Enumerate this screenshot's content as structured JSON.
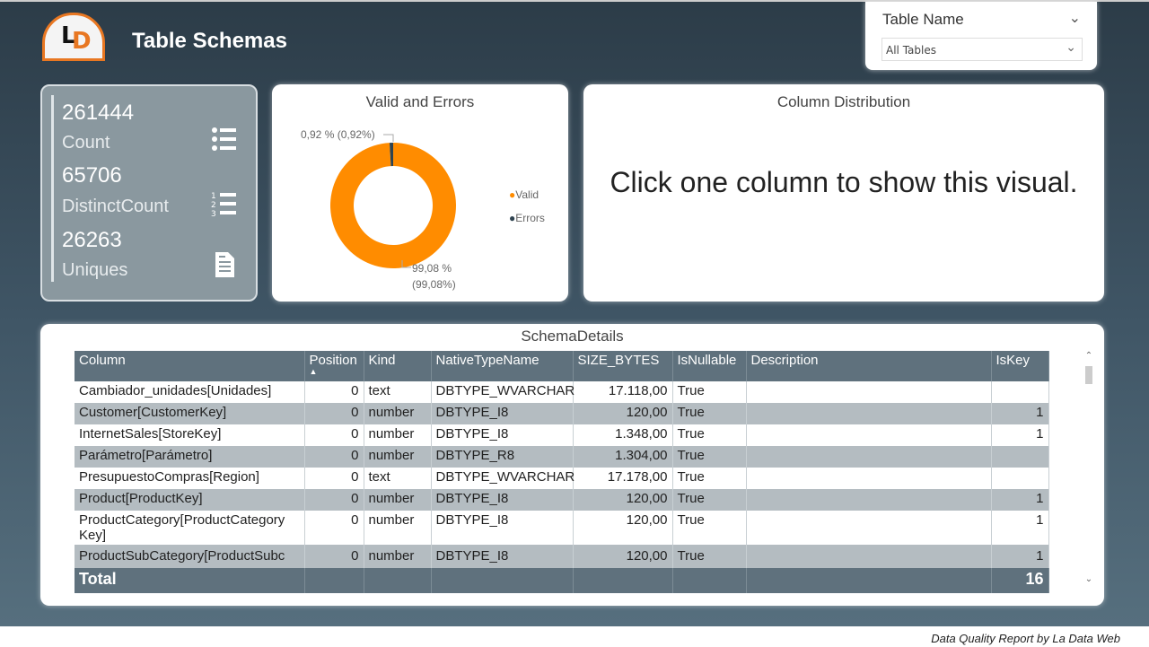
{
  "header": {
    "title": "Table Schemas",
    "logo_text": "LD"
  },
  "slicer": {
    "title": "Table Name",
    "selected": "All Tables"
  },
  "kpis": [
    {
      "value": "261444",
      "label": "Count",
      "icon": "bullet-list-icon"
    },
    {
      "value": "65706",
      "label": "DistinctCount",
      "icon": "numbered-list-icon"
    },
    {
      "value": "26263",
      "label": "Uniques",
      "icon": "document-icon"
    }
  ],
  "donut": {
    "title": "Valid and Errors",
    "errors_label": "0,92 % (0,92%)",
    "valid_label_1": "99,08 %",
    "valid_label_2": "(99,08%)",
    "legend": [
      "Valid",
      "Errors"
    ],
    "chart_data": {
      "type": "pie",
      "categories": [
        "Valid",
        "Errors"
      ],
      "values": [
        99.08,
        0.92
      ],
      "colors": [
        "#ff8c00",
        "#2f4350"
      ],
      "legend": "right"
    }
  },
  "distribution": {
    "title": "Column Distribution",
    "message": "Click one column to show this visual."
  },
  "schema": {
    "title": "SchemaDetails",
    "columns": [
      "Column",
      "Position",
      "Kind",
      "NativeTypeName",
      "SIZE_BYTES",
      "IsNullable",
      "Description",
      "IsKey"
    ],
    "rows": [
      [
        "Cambiador_unidades[Unidades]",
        "0",
        "text",
        "DBTYPE_WVARCHAR",
        "17.118,00",
        "True",
        "",
        ""
      ],
      [
        "Customer[CustomerKey]",
        "0",
        "number",
        "DBTYPE_I8",
        "120,00",
        "True",
        "",
        "1"
      ],
      [
        "InternetSales[StoreKey]",
        "0",
        "number",
        "DBTYPE_I8",
        "1.348,00",
        "True",
        "",
        "1"
      ],
      [
        "Parámetro[Parámetro]",
        "0",
        "number",
        "DBTYPE_R8",
        "1.304,00",
        "True",
        "",
        ""
      ],
      [
        "PresupuestoCompras[Region]",
        "0",
        "text",
        "DBTYPE_WVARCHAR",
        "17.178,00",
        "True",
        "",
        ""
      ],
      [
        "Product[ProductKey]",
        "0",
        "number",
        "DBTYPE_I8",
        "120,00",
        "True",
        "",
        "1"
      ],
      [
        "ProductCategory[ProductCategory Key]",
        "0",
        "number",
        "DBTYPE_I8",
        "120,00",
        "True",
        "",
        "1"
      ],
      [
        "ProductSubCategory[ProductSubc",
        "0",
        "number",
        "DBTYPE_I8",
        "120,00",
        "True",
        "",
        "1"
      ]
    ],
    "total_label": "Total",
    "total_iskey": "16",
    "sort": "Position ascending"
  },
  "footer": "Data Quality Report by La Data Web",
  "colors": {
    "accent": "#ff8c00",
    "header": "#5f717d",
    "alt_row": "#b4bcc1"
  }
}
